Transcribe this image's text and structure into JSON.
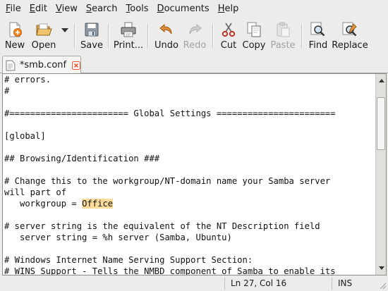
{
  "menubar": {
    "items": [
      {
        "id": "file",
        "mnemonic": "F",
        "rest": "ile"
      },
      {
        "id": "edit",
        "mnemonic": "E",
        "rest": "dit"
      },
      {
        "id": "view",
        "mnemonic": "V",
        "rest": "iew"
      },
      {
        "id": "search",
        "mnemonic": "S",
        "rest": "earch"
      },
      {
        "id": "tools",
        "mnemonic": "T",
        "rest": "ools"
      },
      {
        "id": "documents",
        "mnemonic": "D",
        "rest": "ocuments"
      },
      {
        "id": "help",
        "mnemonic": "H",
        "rest": "elp"
      }
    ]
  },
  "toolbar": {
    "new": {
      "label": "New",
      "icon": "new-document-icon",
      "enabled": true
    },
    "open": {
      "label": "Open",
      "icon": "folder-open-icon",
      "enabled": true
    },
    "save": {
      "label": "Save",
      "icon": "floppy-disk-icon",
      "enabled": true
    },
    "print": {
      "label": "Print...",
      "icon": "printer-icon",
      "enabled": true
    },
    "undo": {
      "label": "Undo",
      "icon": "undo-arrow-icon",
      "enabled": true
    },
    "redo": {
      "label": "Redo",
      "icon": "redo-arrow-icon",
      "enabled": false
    },
    "cut": {
      "label": "Cut",
      "icon": "scissors-icon",
      "enabled": true
    },
    "copy": {
      "label": "Copy",
      "icon": "copy-icon",
      "enabled": true
    },
    "paste": {
      "label": "Paste",
      "icon": "paste-icon",
      "enabled": false
    },
    "find": {
      "label": "Find",
      "icon": "magnifier-icon",
      "enabled": true
    },
    "replace": {
      "label": "Replace",
      "icon": "find-replace-icon",
      "enabled": true
    }
  },
  "tabs": [
    {
      "label": "*smb.conf",
      "modified": true,
      "active": true
    }
  ],
  "editor": {
    "lines": [
      "# errors.",
      "#",
      "",
      "#======================= Global Settings =======================",
      "",
      "[global]",
      "",
      "## Browsing/Identification ###",
      "",
      "# Change this to the workgroup/NT-domain name your Samba server",
      "will part of",
      "   workgroup = |Office|",
      "",
      "# server string is the equivalent of the NT Description field",
      "   server string = %h server (Samba, Ubuntu)",
      "",
      "# Windows Internet Name Serving Support Section:",
      "# WINS Support - Tells the NMBD component of Samba to enable its"
    ],
    "highlight_word": "Office",
    "highlight_color": "#fcdb9b",
    "scroll_fraction": 0.09,
    "scroll_visible_fraction": 0.3
  },
  "statusbar": {
    "position": "Ln 27, Col 16",
    "mode": "INS"
  },
  "colors": {
    "window_bg": "#edeceb",
    "editor_bg": "#ffffff",
    "close_icon": "#e8542b"
  }
}
